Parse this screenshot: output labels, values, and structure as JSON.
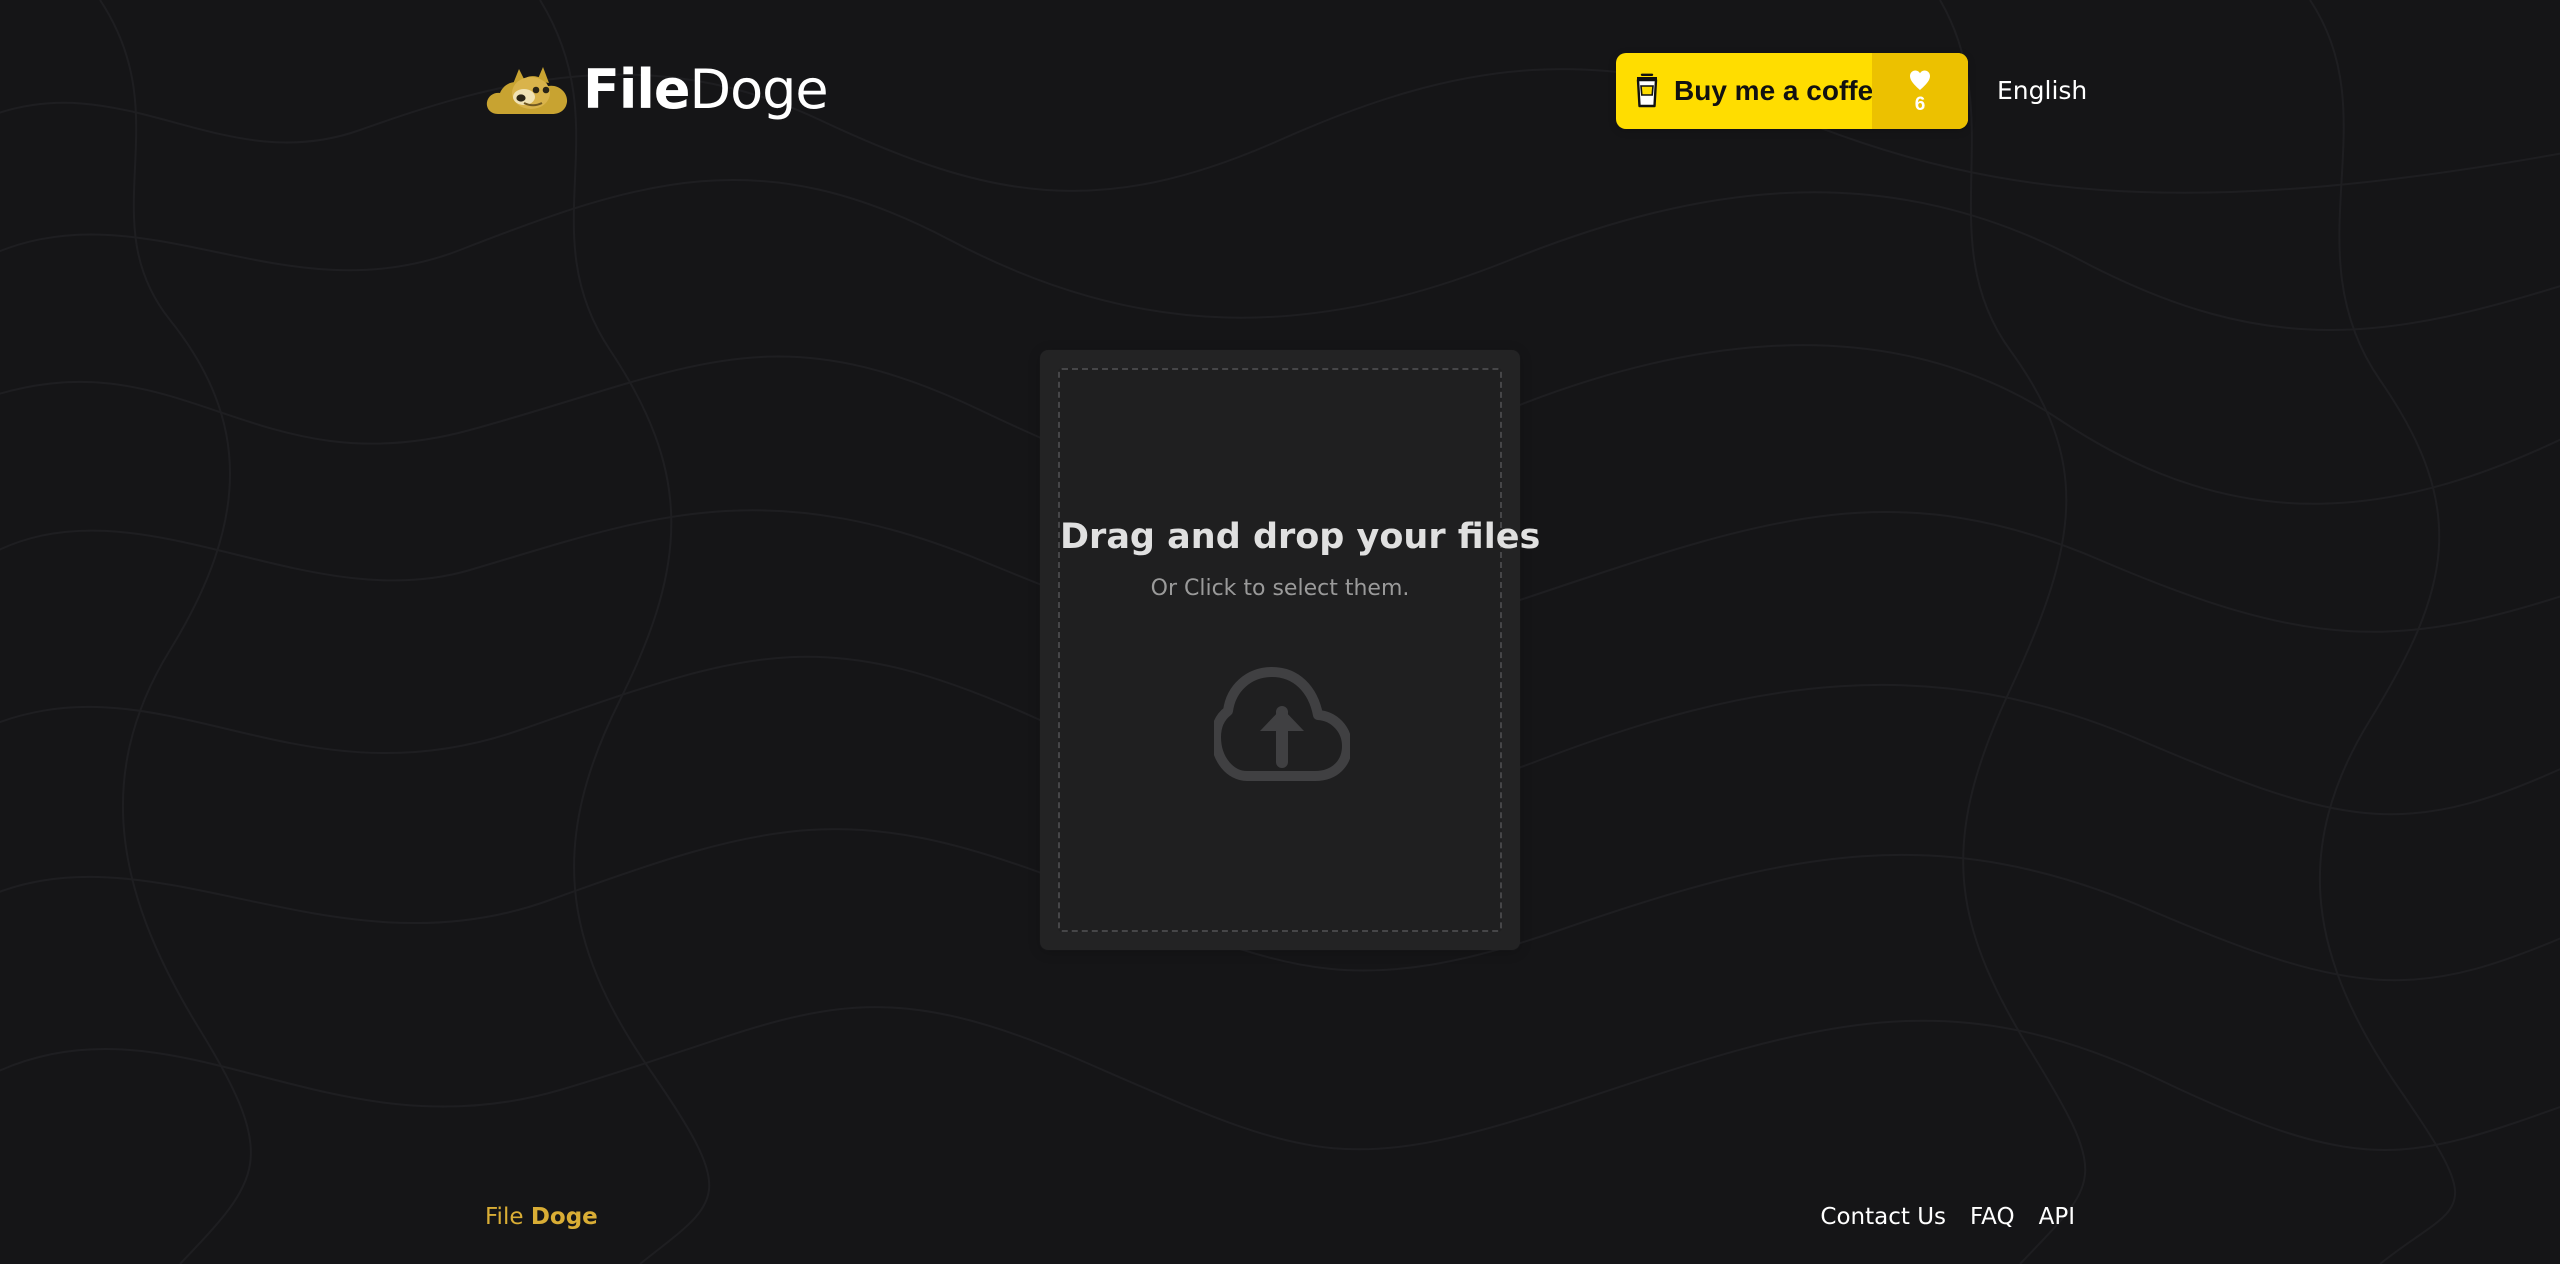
{
  "brand": {
    "logo_icon": "doge-cloud-icon",
    "name_part_1": "File",
    "name_part_2": "Doge",
    "accent_color": "#d9ad35"
  },
  "header": {
    "coffee_label": "Buy me a coffee",
    "coffee_icon": "coffee-cup-icon",
    "coffee_bg": "#ffdd00",
    "heart_icon": "heart-icon",
    "heart_count": "6",
    "language": "English"
  },
  "upload": {
    "title": "Drag and drop your files",
    "subtitle": "Or Click to select them.",
    "icon": "upload-cloud-icon"
  },
  "footer": {
    "brand_part_1": "File",
    "brand_part_2": "Doge",
    "links": [
      {
        "label": "Contact Us"
      },
      {
        "label": "FAQ"
      },
      {
        "label": "API"
      }
    ]
  }
}
